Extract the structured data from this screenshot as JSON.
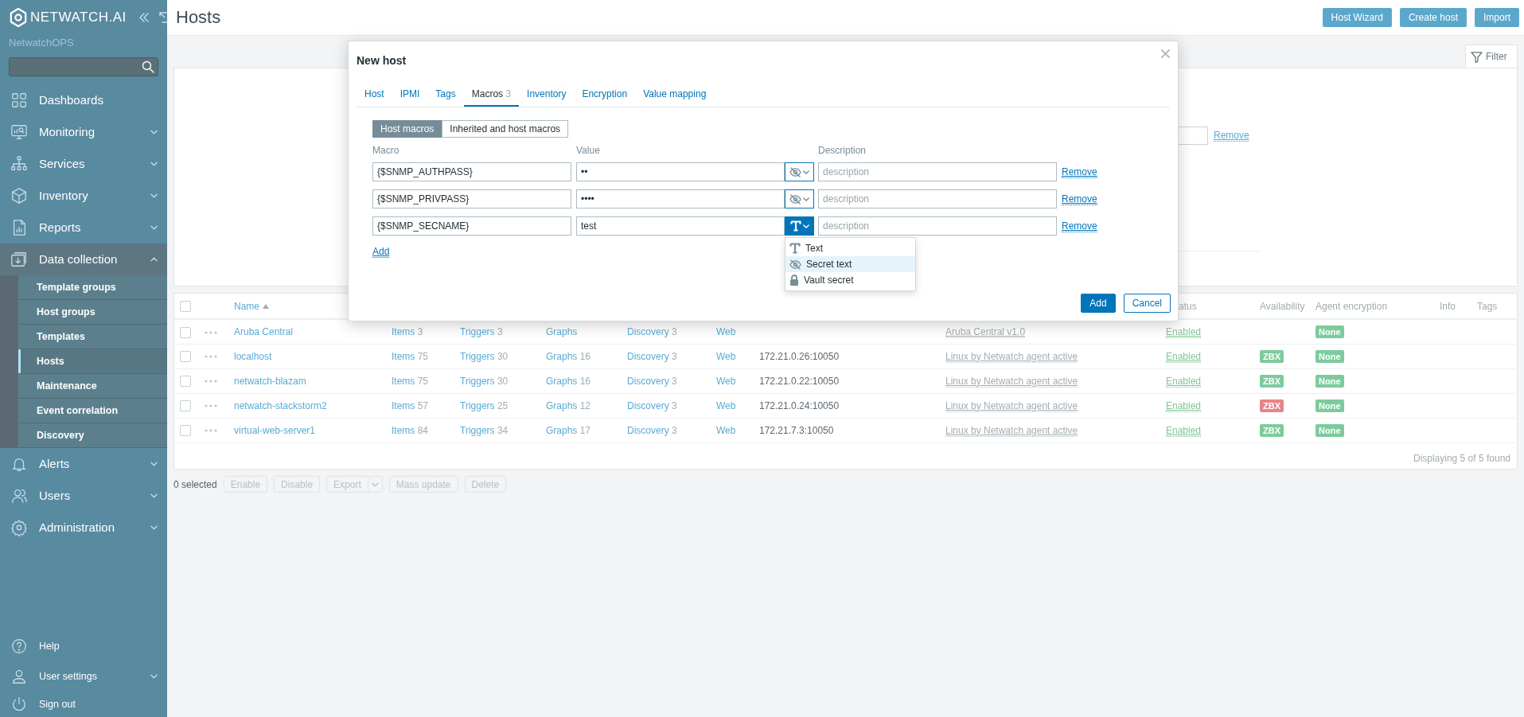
{
  "sidebar": {
    "logo": "NETWATCH.AI",
    "subtitle": "NetwatchOPS",
    "menu": [
      {
        "label": "Dashboards",
        "expandable": false,
        "expanded": false
      },
      {
        "label": "Monitoring",
        "expandable": true,
        "expanded": false
      },
      {
        "label": "Services",
        "expandable": true,
        "expanded": false
      },
      {
        "label": "Inventory",
        "expandable": true,
        "expanded": false
      },
      {
        "label": "Reports",
        "expandable": true,
        "expanded": false
      },
      {
        "label": "Data collection",
        "expandable": true,
        "expanded": true,
        "children": [
          {
            "label": "Template groups",
            "selected": false
          },
          {
            "label": "Host groups",
            "selected": false
          },
          {
            "label": "Templates",
            "selected": false
          },
          {
            "label": "Hosts",
            "selected": true
          },
          {
            "label": "Maintenance",
            "selected": false
          },
          {
            "label": "Event correlation",
            "selected": false
          },
          {
            "label": "Discovery",
            "selected": false
          }
        ]
      },
      {
        "label": "Alerts",
        "expandable": true,
        "expanded": false
      },
      {
        "label": "Users",
        "expandable": true,
        "expanded": false
      },
      {
        "label": "Administration",
        "expandable": true,
        "expanded": false
      }
    ],
    "footer_menu": [
      {
        "label": "Help",
        "expandable": false,
        "expanded": false
      },
      {
        "label": "User settings",
        "expandable": true,
        "expanded": false
      },
      {
        "label": "Sign out",
        "expandable": false,
        "expanded": false
      }
    ]
  },
  "header": {
    "title": "Hosts",
    "buttons": [
      "Host Wizard",
      "Create host",
      "Import"
    ]
  },
  "filter": {
    "tab": "Filter",
    "remove_link": "Remove"
  },
  "table": {
    "all_checked": false,
    "columns": [
      {
        "label": "Name",
        "sort_ascending": true
      },
      {
        "label": "atus"
      },
      {
        "label": "Availability"
      },
      {
        "label": "Agent encryption"
      },
      {
        "label": "Info"
      },
      {
        "label": "Tags"
      }
    ],
    "rows": [
      {
        "checked": false,
        "name": "Aruba Central",
        "links": [
          {
            "label": "Items",
            "count": "3"
          },
          {
            "label": "Triggers",
            "count": "3"
          },
          {
            "label": "Graphs"
          },
          {
            "label": "Discovery",
            "count": "3"
          },
          {
            "label": "Web"
          }
        ],
        "template": "Aruba Central v1.0",
        "status": "Enabled",
        "encryption": "None"
      },
      {
        "checked": false,
        "name": "localhost",
        "links": [
          {
            "label": "Items",
            "count": "75"
          },
          {
            "label": "Triggers",
            "count": "30"
          },
          {
            "label": "Graphs",
            "count": "16"
          },
          {
            "label": "Discovery",
            "count": "3"
          },
          {
            "label": "Web"
          }
        ],
        "interface": "172.21.0.26:10050",
        "template": "Linux by Netwatch agent active",
        "status": "Enabled",
        "availability": {
          "label": "ZBX",
          "color": "#7dcb9d"
        },
        "encryption": "None"
      },
      {
        "checked": false,
        "name": "netwatch-blazam",
        "links": [
          {
            "label": "Items",
            "count": "75"
          },
          {
            "label": "Triggers",
            "count": "30"
          },
          {
            "label": "Graphs",
            "count": "16"
          },
          {
            "label": "Discovery",
            "count": "3"
          },
          {
            "label": "Web"
          }
        ],
        "interface": "172.21.0.22:10050",
        "template": "Linux by Netwatch agent active",
        "status": "Enabled",
        "availability": {
          "label": "ZBX",
          "color": "#7dcb9d"
        },
        "encryption": "None"
      },
      {
        "checked": false,
        "name": "netwatch-stackstorm2",
        "links": [
          {
            "label": "Items",
            "count": "57"
          },
          {
            "label": "Triggers",
            "count": "25"
          },
          {
            "label": "Graphs",
            "count": "12"
          },
          {
            "label": "Discovery",
            "count": "3"
          },
          {
            "label": "Web"
          }
        ],
        "interface": "172.21.0.24:10050",
        "template": "Linux by Netwatch agent active",
        "status": "Enabled",
        "availability": {
          "label": "ZBX",
          "color": "#e8848b"
        },
        "encryption": "None"
      },
      {
        "checked": false,
        "name": "virtual-web-server1",
        "links": [
          {
            "label": "Items",
            "count": "84"
          },
          {
            "label": "Triggers",
            "count": "34"
          },
          {
            "label": "Graphs",
            "count": "17"
          },
          {
            "label": "Discovery",
            "count": "3"
          },
          {
            "label": "Web"
          }
        ],
        "interface": "172.21.7.3:10050",
        "template": "Linux by Netwatch agent active",
        "status": "Enabled",
        "availability": {
          "label": "ZBX",
          "color": "#7dcb9d"
        },
        "encryption": "None"
      }
    ],
    "footer": "Displaying 5 of 5 found"
  },
  "bulk": {
    "count_label": "0 selected",
    "buttons": [
      {
        "label": "Enable",
        "disabled": true
      },
      {
        "label": "Disable",
        "disabled": true
      },
      {
        "label": "Export",
        "disabled": true,
        "menu": true
      },
      {
        "label": "Mass update",
        "disabled": true
      },
      {
        "label": "Delete",
        "disabled": true
      }
    ]
  },
  "modal": {
    "title": "New host",
    "tabs": [
      {
        "label": "Host",
        "selected": false
      },
      {
        "label": "IPMI",
        "selected": false
      },
      {
        "label": "Tags",
        "selected": false
      },
      {
        "label": "Macros",
        "count": "3",
        "selected": true
      },
      {
        "label": "Inventory",
        "selected": false
      },
      {
        "label": "Encryption",
        "selected": false
      },
      {
        "label": "Value mapping",
        "selected": false
      }
    ],
    "segments": [
      {
        "label": "Host macros",
        "selected": true
      },
      {
        "label": "Inherited and host macros",
        "selected": false
      }
    ],
    "columns": [
      "Macro",
      "Value",
      "Description"
    ],
    "macros": [
      {
        "macro": "{$SNMP_AUTHPASS}",
        "value": "••",
        "kind": "secret",
        "placeholder": "description",
        "remove": "Remove"
      },
      {
        "macro": "{$SNMP_PRIVPASS}",
        "value": "••••",
        "kind": "secret",
        "placeholder": "description",
        "remove": "Remove"
      },
      {
        "macro": "{$SNMP_SECNAME}",
        "value": "test",
        "kind": "text",
        "placeholder": "description",
        "remove": "Remove",
        "type_menu": [
          {
            "label": "Text",
            "kind": "text",
            "selected": false
          },
          {
            "label": "Secret text",
            "kind": "secret",
            "selected": true
          },
          {
            "label": "Vault secret",
            "kind": "vault",
            "selected": false
          }
        ]
      }
    ],
    "add_link": "Add",
    "buttons": [
      {
        "label": "Add",
        "kind": "primary"
      },
      {
        "label": "Cancel",
        "kind": "secondary"
      }
    ]
  }
}
